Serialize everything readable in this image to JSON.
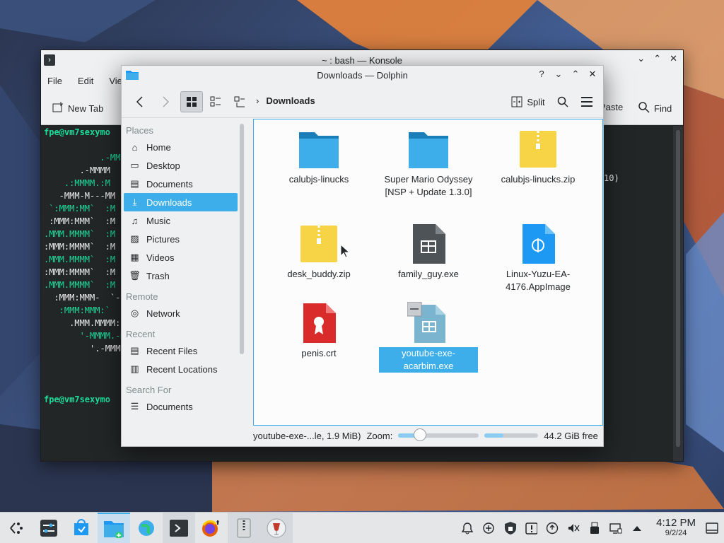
{
  "konsole": {
    "title": "~ : bash — Konsole",
    "menu": [
      "File",
      "Edit",
      "View"
    ],
    "toolbar": {
      "new_tab": "New Tab",
      "paste": "Paste",
      "find": "Find"
    },
    "lines": [
      {
        "user": "fpe@vm7sexymo",
        "rest": ""
      },
      {
        "user": "",
        "rest": "               ."
      },
      {
        "user": "",
        "rest": "           .-MM"
      },
      {
        "user": "",
        "rest": "       .-MMMM"
      },
      {
        "user": "",
        "rest": "    .:MMMM.:M"
      },
      {
        "user": "",
        "rest": "   -MMM-M---MM"
      },
      {
        "user": "",
        "rest": " `:MMM:MM`  :M"
      },
      {
        "user": "",
        "rest": " :MMM:MMM`  :M"
      },
      {
        "user": "",
        "rest": ".MMM.MMMM`  :M"
      },
      {
        "user": "",
        "rest": ":MMM:MMMM`  :M"
      },
      {
        "user": "",
        "rest": ".MMM.MMMM`  :M"
      },
      {
        "user": "",
        "rest": ":MMM:MMMM`  :M"
      },
      {
        "user": "",
        "rest": ".MMM.MMMM`  :M"
      },
      {
        "user": "",
        "rest": "  :MMM:MMM-  `-"
      },
      {
        "user": "",
        "rest": "   :MMM:MMM:`"
      },
      {
        "user": "",
        "rest": "     .MMM.MMMM:"
      },
      {
        "user": "",
        "rest": "       '-MMMM.-M"
      },
      {
        "user": "",
        "rest": "         '.-MMMM"
      },
      {
        "user": "",
        "rest": "               '-"
      },
      {
        "user": "",
        "rest": ""
      },
      {
        "user": "",
        "rest": ""
      },
      {
        "user": "fpe@vm7sexymo",
        "rest": ""
      }
    ],
    "right_fragment": "10)"
  },
  "dolphin": {
    "title": "Downloads — Dolphin",
    "breadcrumb": "Downloads",
    "split_label": "Split",
    "places": {
      "places_header": "Places",
      "items": [
        {
          "label": "Home",
          "icon": "home-icon"
        },
        {
          "label": "Desktop",
          "icon": "desktop-icon"
        },
        {
          "label": "Documents",
          "icon": "documents-icon"
        },
        {
          "label": "Downloads",
          "icon": "downloads-icon"
        },
        {
          "label": "Music",
          "icon": "music-icon"
        },
        {
          "label": "Pictures",
          "icon": "pictures-icon"
        },
        {
          "label": "Videos",
          "icon": "videos-icon"
        },
        {
          "label": "Trash",
          "icon": "trash-icon"
        }
      ],
      "remote_header": "Remote",
      "remote_items": [
        {
          "label": "Network",
          "icon": "network-icon"
        }
      ],
      "recent_header": "Recent",
      "recent_items": [
        {
          "label": "Recent Files",
          "icon": "recent-files-icon"
        },
        {
          "label": "Recent Locations",
          "icon": "recent-locations-icon"
        }
      ],
      "search_header": "Search For",
      "search_items": [
        {
          "label": "Documents",
          "icon": "search-documents-icon"
        }
      ]
    },
    "files": [
      {
        "name": "calubjs-linucks",
        "type": "folder"
      },
      {
        "name": "Super Mario Odyssey [NSP + Update 1.3.0]",
        "type": "folder"
      },
      {
        "name": "calubjs-linucks.zip",
        "type": "zip"
      },
      {
        "name": "desk_buddy.zip",
        "type": "zip"
      },
      {
        "name": "family_guy.exe",
        "type": "exe"
      },
      {
        "name": "Linux-Yuzu-EA-4176.AppImage",
        "type": "appimage"
      },
      {
        "name": "penis.crt",
        "type": "crt"
      },
      {
        "name": "youtube-exe-acarbim.exe",
        "type": "exe-selected"
      }
    ],
    "status": {
      "selection": "youtube-exe-...le, 1.9 MiB)",
      "zoom_label": "Zoom:",
      "zoom_level": 0.27,
      "free_used_fraction": 0.35,
      "free_space": "44.2 GiB free"
    }
  },
  "taskbar": {
    "apps": [
      {
        "name": "app-launcher-icon",
        "state": "normal"
      },
      {
        "name": "system-settings-icon",
        "state": "normal"
      },
      {
        "name": "discover-icon",
        "state": "normal"
      },
      {
        "name": "dolphin-icon",
        "state": "active"
      },
      {
        "name": "web-browser-icon",
        "state": "normal"
      },
      {
        "name": "konsole-icon",
        "state": "running"
      },
      {
        "name": "firefox-icon",
        "state": "normal"
      },
      {
        "name": "archive-icon",
        "state": "running"
      },
      {
        "name": "wine-icon",
        "state": "running"
      }
    ],
    "tray": [
      "notifications-icon",
      "kde-connect-icon",
      "vault-icon",
      "updates-icon",
      "network-status-icon",
      "volume-muted-icon",
      "usb-icon",
      "display-icon",
      "expand-tray-icon"
    ],
    "time": "4:12 PM",
    "date": "9/2/24"
  },
  "colors": {
    "accent": "#3daee9",
    "terminal_bg": "#232627",
    "terminal_green": "#1cdc9a",
    "folder_blue": "#3daee9",
    "zip_yellow": "#f6d445",
    "crt_red": "#da2b2b"
  }
}
